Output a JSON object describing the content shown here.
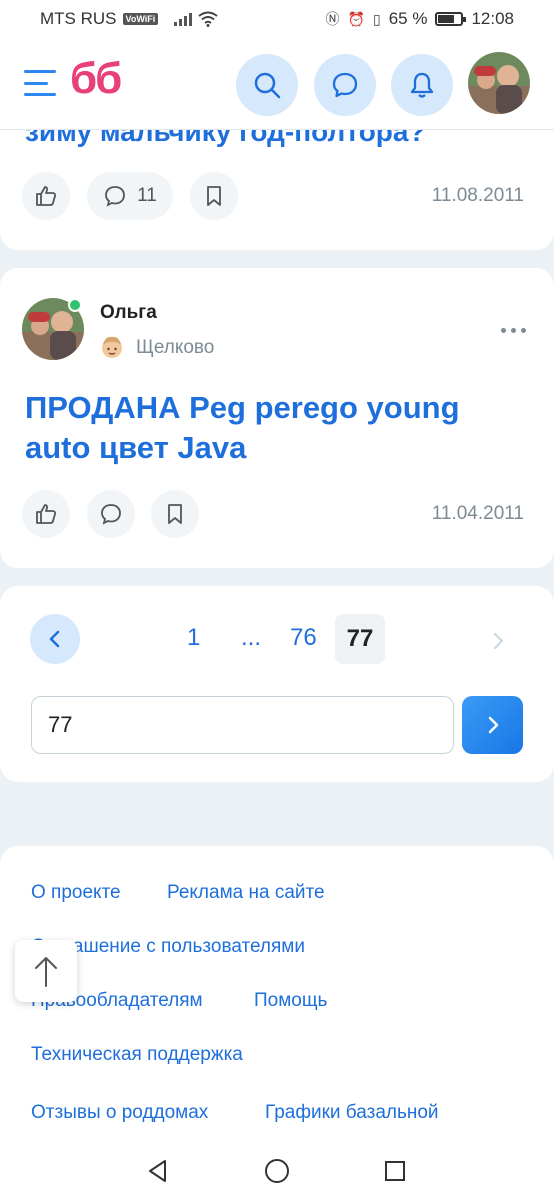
{
  "status_bar": {
    "carrier": "MTS RUS",
    "vowifi": "VoWiFi",
    "battery": "65 %",
    "time": "12:08"
  },
  "header": {
    "logo": "бб",
    "icons": [
      "menu-icon",
      "search-icon",
      "chat-icon",
      "bell-icon",
      "avatar"
    ]
  },
  "prev_post": {
    "title_fragment": "зиму мальчику год-полтора?",
    "comments": "11",
    "date": "11.08.2011"
  },
  "post": {
    "author": "Ольга",
    "city": "Щелково",
    "title": "ПРОДАНА Peg perego young auto цвет Java",
    "date": "11.04.2011"
  },
  "pagination": {
    "first": "1",
    "ellipsis": "...",
    "prev_page": "76",
    "current": "77",
    "input_value": "77"
  },
  "footer": {
    "links": [
      "О проекте",
      "Реклама на сайте",
      "Соглашение с пользователями",
      "Правообладателям",
      "Помощь",
      "Техническая поддержка",
      "Отзывы о роддомах",
      "Графики базальной"
    ]
  },
  "colors": {
    "brand": "#e8407a",
    "accent": "#1e6fdc",
    "icon_bg": "#d6e8fb",
    "online": "#30c470"
  }
}
